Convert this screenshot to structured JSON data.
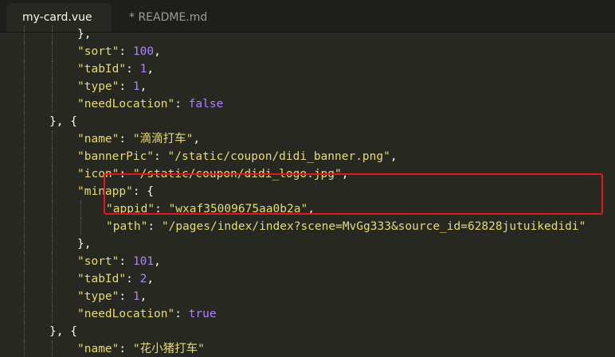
{
  "tabs": [
    {
      "label": "my-card.vue"
    },
    {
      "label": "* README.md"
    }
  ],
  "colors": {
    "background": "#272822",
    "string": "#e6db74",
    "number": "#ae81ff",
    "highlight_box": "#e0181b"
  },
  "code_lines": [
    {
      "indent": 2,
      "tokens": [
        {
          "t": "p",
          "v": "},"
        }
      ]
    },
    {
      "indent": 2,
      "tokens": [
        {
          "t": "k",
          "v": "\"sort\""
        },
        {
          "t": "p",
          "v": ": "
        },
        {
          "t": "n",
          "v": "100"
        },
        {
          "t": "p",
          "v": ","
        }
      ]
    },
    {
      "indent": 2,
      "tokens": [
        {
          "t": "k",
          "v": "\"tabId\""
        },
        {
          "t": "p",
          "v": ": "
        },
        {
          "t": "n",
          "v": "1"
        },
        {
          "t": "p",
          "v": ","
        }
      ]
    },
    {
      "indent": 2,
      "tokens": [
        {
          "t": "k",
          "v": "\"type\""
        },
        {
          "t": "p",
          "v": ": "
        },
        {
          "t": "n",
          "v": "1"
        },
        {
          "t": "p",
          "v": ","
        }
      ]
    },
    {
      "indent": 2,
      "tokens": [
        {
          "t": "k",
          "v": "\"needLocation\""
        },
        {
          "t": "p",
          "v": ": "
        },
        {
          "t": "n",
          "v": "false"
        }
      ]
    },
    {
      "indent": 1,
      "tokens": [
        {
          "t": "p",
          "v": "}, {"
        }
      ]
    },
    {
      "indent": 2,
      "tokens": [
        {
          "t": "k",
          "v": "\"name\""
        },
        {
          "t": "p",
          "v": ": "
        },
        {
          "t": "k",
          "v": "\"滴滴打车\""
        },
        {
          "t": "p",
          "v": ","
        }
      ]
    },
    {
      "indent": 2,
      "tokens": [
        {
          "t": "k",
          "v": "\"bannerPic\""
        },
        {
          "t": "p",
          "v": ": "
        },
        {
          "t": "k",
          "v": "\"/static/coupon/didi_banner.png\""
        },
        {
          "t": "p",
          "v": ","
        }
      ]
    },
    {
      "indent": 2,
      "tokens": [
        {
          "t": "k",
          "v": "\"icon\""
        },
        {
          "t": "p",
          "v": ": "
        },
        {
          "t": "k",
          "v": "\"/static/coupon/didi_logo.jpg\""
        },
        {
          "t": "p",
          "v": ","
        }
      ]
    },
    {
      "indent": 2,
      "tokens": [
        {
          "t": "k",
          "v": "\"minapp\""
        },
        {
          "t": "p",
          "v": ": {"
        }
      ]
    },
    {
      "indent": 3,
      "tokens": [
        {
          "t": "k",
          "v": "\"appid\""
        },
        {
          "t": "p",
          "v": ": "
        },
        {
          "t": "k",
          "v": "\"wxaf35009675aa0b2a\""
        },
        {
          "t": "p",
          "v": ","
        }
      ]
    },
    {
      "indent": 3,
      "tokens": [
        {
          "t": "k",
          "v": "\"path\""
        },
        {
          "t": "p",
          "v": ": "
        },
        {
          "t": "k",
          "v": "\"/pages/index/index?scene=MvGg333&source_id=62828jutuikedidi\""
        }
      ]
    },
    {
      "indent": 2,
      "tokens": [
        {
          "t": "p",
          "v": "},"
        }
      ]
    },
    {
      "indent": 2,
      "tokens": [
        {
          "t": "k",
          "v": "\"sort\""
        },
        {
          "t": "p",
          "v": ": "
        },
        {
          "t": "n",
          "v": "101"
        },
        {
          "t": "p",
          "v": ","
        }
      ]
    },
    {
      "indent": 2,
      "tokens": [
        {
          "t": "k",
          "v": "\"tabId\""
        },
        {
          "t": "p",
          "v": ": "
        },
        {
          "t": "n",
          "v": "2"
        },
        {
          "t": "p",
          "v": ","
        }
      ]
    },
    {
      "indent": 2,
      "tokens": [
        {
          "t": "k",
          "v": "\"type\""
        },
        {
          "t": "p",
          "v": ": "
        },
        {
          "t": "n",
          "v": "1"
        },
        {
          "t": "p",
          "v": ","
        }
      ]
    },
    {
      "indent": 2,
      "tokens": [
        {
          "t": "k",
          "v": "\"needLocation\""
        },
        {
          "t": "p",
          "v": ": "
        },
        {
          "t": "n",
          "v": "true"
        }
      ]
    },
    {
      "indent": 1,
      "tokens": [
        {
          "t": "p",
          "v": "}, {"
        }
      ]
    },
    {
      "indent": 2,
      "tokens": [
        {
          "t": "k",
          "v": "\"name\""
        },
        {
          "t": "p",
          "v": ": "
        },
        {
          "t": "k",
          "v": "\"花小猪打车\""
        }
      ]
    }
  ]
}
